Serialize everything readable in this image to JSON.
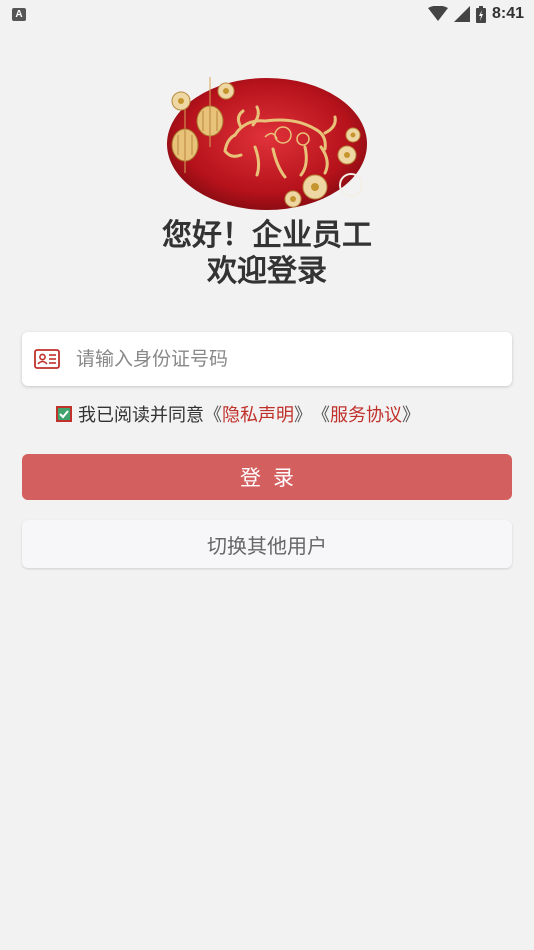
{
  "status_bar": {
    "left_icon_letter": "A",
    "time": "8:41"
  },
  "greeting": {
    "line1": "您好！企业员工",
    "line2": "欢迎登录"
  },
  "id_input": {
    "placeholder": "请输入身份证号码",
    "value": ""
  },
  "agreement": {
    "checked": true,
    "prefix": "我已阅读并同意",
    "open_bracket": "《",
    "close_bracket": "》",
    "privacy_link": "隐私声明",
    "service_link": "服务协议"
  },
  "buttons": {
    "login_label": "登录",
    "switch_user_label": "切换其他用户"
  },
  "colors": {
    "accent_red": "#c0312b",
    "login_button": "#d45f5f",
    "background": "#f2f2f2"
  },
  "icons": {
    "input_icon": "id-card-icon",
    "checkbox_icon": "checkmark-icon"
  }
}
